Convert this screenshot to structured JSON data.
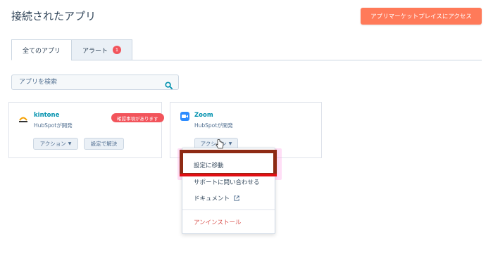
{
  "header": {
    "title": "接続されたアプリ",
    "marketplace_button": "アプリマーケットプレイスにアクセス"
  },
  "tabs": [
    {
      "label": "全てのアプリ",
      "active": true
    },
    {
      "label": "アラート",
      "badge": "1",
      "active": false
    }
  ],
  "search": {
    "placeholder": "アプリを検索",
    "value": ""
  },
  "apps": [
    {
      "name": "kintone",
      "developer": "HubSpotが開発",
      "warning_badge": "確認事項があります",
      "actions_button": "アクション",
      "settings_button": "設定で解決",
      "icon": "kintone-logo-icon"
    },
    {
      "name": "Zoom",
      "developer": "HubSpotが開発",
      "actions_button": "アクション",
      "icon": "zoom-video-icon"
    }
  ],
  "dropdown_menu": {
    "items": [
      "設定に移動",
      "サポートに問い合わせる",
      "ドキュメント",
      "アンインストール"
    ],
    "external_icon": "external-link-icon"
  },
  "colors": {
    "accent": "#ff7a59",
    "link": "#0091ae",
    "warning": "#f2545b",
    "highlight": "#8e2a14"
  }
}
